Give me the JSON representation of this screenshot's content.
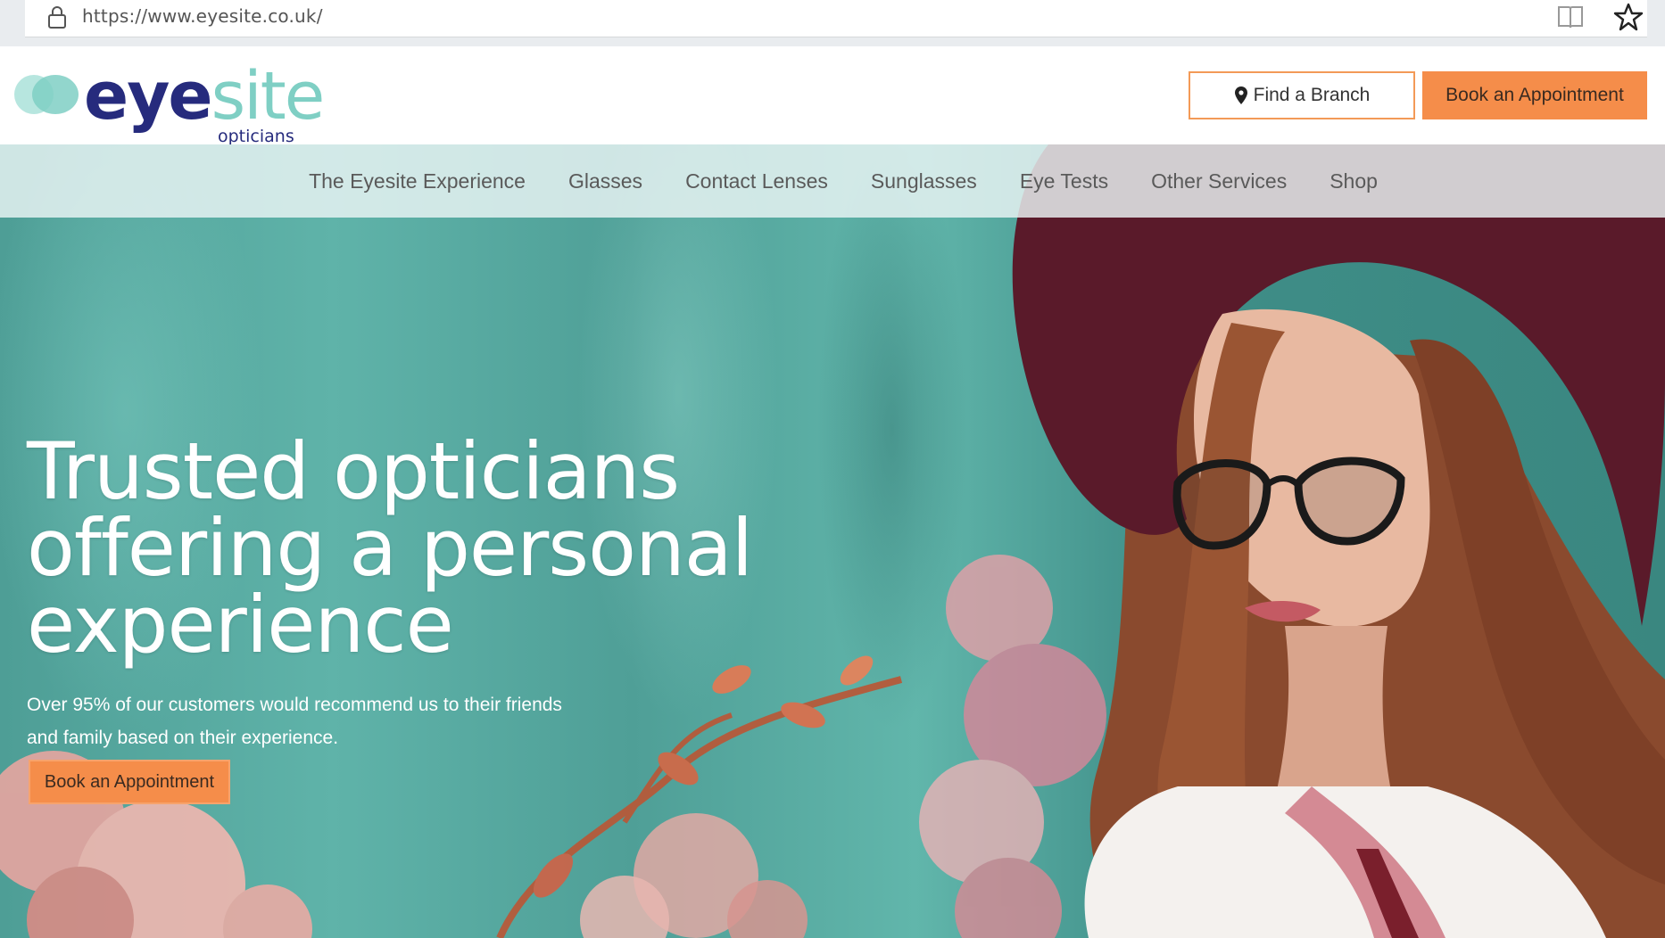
{
  "browser": {
    "url": "https://www.eyesite.co.uk/",
    "icons": [
      "lock-icon",
      "reader-view-icon",
      "favorite-star-icon"
    ]
  },
  "header": {
    "logo": {
      "word_part1": "eye",
      "word_part2": "site",
      "subtitle": "opticians"
    },
    "find_branch_label": "Find a Branch",
    "book_label": "Book an Appointment"
  },
  "nav": {
    "items": [
      {
        "label": "The Eyesite Experience"
      },
      {
        "label": "Glasses"
      },
      {
        "label": "Contact Lenses"
      },
      {
        "label": "Sunglasses"
      },
      {
        "label": "Eye Tests"
      },
      {
        "label": "Other Services"
      },
      {
        "label": "Shop"
      }
    ]
  },
  "hero": {
    "title_line1": "Trusted opticians",
    "title_line2": "offering a personal",
    "title_line3": "experience",
    "subtitle_line1": "Over 95% of our customers would recommend us to their friends",
    "subtitle_line2": "and family based on their experience.",
    "cta_label": "Book an Appointment"
  },
  "colors": {
    "brand_navy": "#262b7d",
    "brand_teal": "#7fcfc4",
    "accent_orange": "#f58d4a",
    "hero_teal": "#5fb3a9"
  }
}
